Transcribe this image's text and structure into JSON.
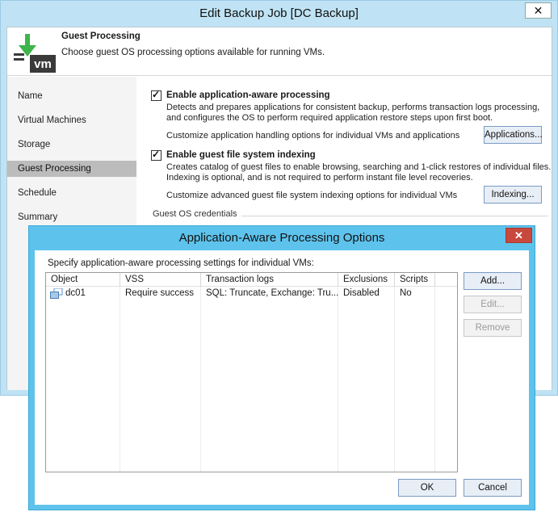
{
  "back_window": {
    "title": "Edit Backup Job [DC Backup]",
    "close_glyph": "✕",
    "header": {
      "title": "Guest Processing",
      "subtitle": "Choose guest OS processing options available for running VMs.",
      "icon": "vm-download-icon",
      "logo_text": "vm"
    },
    "nav": {
      "items": [
        {
          "label": "Name",
          "active": false
        },
        {
          "label": "Virtual Machines",
          "active": false
        },
        {
          "label": "Storage",
          "active": false
        },
        {
          "label": "Guest Processing",
          "active": true
        },
        {
          "label": "Schedule",
          "active": false
        },
        {
          "label": "Summary",
          "active": false
        }
      ]
    },
    "app_aware": {
      "checked": true,
      "label": "Enable application-aware processing",
      "desc1": "Detects and prepares applications for consistent backup, performs transaction logs processing,",
      "desc2": "and configures the OS to perform required application restore steps upon first boot.",
      "customize": "Customize application handling options for individual VMs and applications",
      "button": "Applications..."
    },
    "indexing": {
      "checked": true,
      "label": "Enable guest file system indexing",
      "desc1": "Creates catalog of guest files to enable browsing, searching and 1-click restores of individual files.",
      "desc2": "Indexing is optional, and is not required to perform instant file level recoveries.",
      "customize": "Customize advanced guest file system indexing options for individual VMs",
      "button": "Indexing..."
    },
    "credentials_label": "Guest OS credentials"
  },
  "dialog": {
    "title": "Application-Aware Processing Options",
    "close_glyph": "✕",
    "caption": "Specify application-aware processing settings for individual VMs:",
    "columns": [
      "Object",
      "VSS",
      "Transaction logs",
      "Exclusions",
      "Scripts"
    ],
    "rows": [
      {
        "object": "dc01",
        "vss": "Require success",
        "transaction_logs": "SQL: Truncate, Exchange: Tru...",
        "exclusions": "Disabled",
        "scripts": "No"
      }
    ],
    "buttons": {
      "add": "Add...",
      "edit": "Edit...",
      "remove": "Remove",
      "ok": "OK",
      "cancel": "Cancel"
    }
  },
  "colors": {
    "back_frame": "#bfe3f4",
    "dialog_frame": "#5ec3ec",
    "close_red": "#c9483d",
    "nav_active": "#bcbcbc",
    "logo_green": "#3db54a",
    "logo_dark": "#3a3a3a"
  }
}
